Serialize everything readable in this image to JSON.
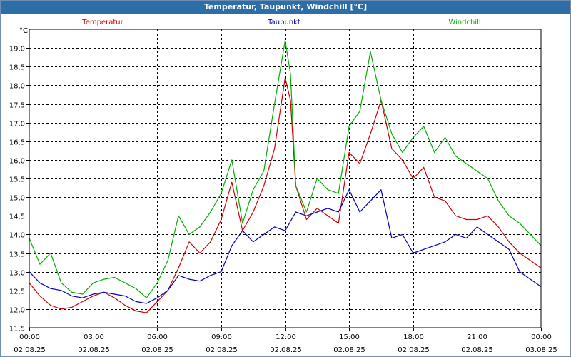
{
  "window": {
    "title": "Temperatur, Taupunkt, Windchill [°C]"
  },
  "colors": {
    "temperatur": "#d00000",
    "taupunkt": "#0000c0",
    "windchill": "#00b000",
    "grid": "#000000",
    "background": "#ffffff",
    "titlebar": "#2e6ea6"
  },
  "chart_data": {
    "type": "line",
    "title": "Temperatur, Taupunkt, Windchill [°C]",
    "ylabel": "°C",
    "ylim": [
      11.5,
      19.5
    ],
    "y_ticks": [
      11.5,
      12.0,
      12.5,
      13.0,
      13.5,
      14.0,
      14.5,
      15.0,
      15.5,
      16.0,
      16.5,
      17.0,
      17.5,
      18.0,
      18.5,
      19.0
    ],
    "y_tick_labels": [
      "11,5",
      "12,0",
      "12,5",
      "13,0",
      "13,5",
      "14,0",
      "14,5",
      "15,0",
      "15,5",
      "16,0",
      "16,5",
      "17,0",
      "17,5",
      "18,0",
      "18,5",
      "19,0"
    ],
    "x_ticks": [
      {
        "time": "00:00",
        "date": "02.08.25"
      },
      {
        "time": "03:00",
        "date": "02.08.25"
      },
      {
        "time": "06:00",
        "date": "02.08.25"
      },
      {
        "time": "09:00",
        "date": "02.08.25"
      },
      {
        "time": "12:00",
        "date": "02.08.25"
      },
      {
        "time": "15:00",
        "date": "02.08.25"
      },
      {
        "time": "18:00",
        "date": "02.08.25"
      },
      {
        "time": "21:00",
        "date": "02.08.25"
      },
      {
        "time": "00:00",
        "date": "03.08.25"
      }
    ],
    "xlim_hours": [
      0,
      24
    ],
    "grid": true,
    "legend_position": "top",
    "series": [
      {
        "name": "Temperatur",
        "color": "#d00000",
        "x": [
          0,
          0.5,
          1,
          1.5,
          2,
          2.5,
          3,
          3.5,
          4,
          4.5,
          5,
          5.5,
          6,
          6.5,
          7,
          7.5,
          8,
          8.5,
          9,
          9.5,
          10,
          10.5,
          11,
          11.5,
          12,
          12.25,
          12.5,
          13,
          13.5,
          14,
          14.5,
          15,
          15.5,
          16,
          16.5,
          17,
          17.5,
          18,
          18.5,
          19,
          19.5,
          20,
          20.5,
          21,
          21.5,
          22,
          22.5,
          23,
          23.5,
          24
        ],
        "y": [
          12.7,
          12.35,
          12.1,
          12.0,
          12.05,
          12.2,
          12.35,
          12.45,
          12.3,
          12.1,
          11.95,
          11.9,
          12.2,
          12.5,
          13.1,
          13.8,
          13.5,
          13.8,
          14.4,
          15.4,
          14.1,
          14.6,
          15.3,
          16.3,
          18.2,
          17.6,
          15.3,
          14.4,
          14.7,
          14.5,
          14.3,
          16.2,
          15.9,
          16.7,
          17.6,
          16.3,
          16.0,
          15.5,
          15.8,
          15.0,
          14.9,
          14.5,
          14.4,
          14.4,
          14.5,
          14.2,
          13.8,
          13.5,
          13.3,
          13.1
        ]
      },
      {
        "name": "Taupunkt",
        "color": "#0000c0",
        "x": [
          0,
          0.5,
          1,
          1.5,
          2,
          2.5,
          3,
          3.5,
          4,
          4.5,
          5,
          5.5,
          6,
          6.5,
          7,
          7.5,
          8,
          8.5,
          9,
          9.5,
          10,
          10.5,
          11,
          11.5,
          12,
          12.5,
          13,
          13.5,
          14,
          14.5,
          15,
          15.5,
          16,
          16.5,
          17,
          17.5,
          18,
          18.5,
          19,
          19.5,
          20,
          20.5,
          21,
          21.5,
          22,
          22.5,
          23,
          23.5,
          24
        ],
        "y": [
          13.0,
          12.7,
          12.55,
          12.5,
          12.35,
          12.3,
          12.4,
          12.45,
          12.4,
          12.35,
          12.2,
          12.15,
          12.3,
          12.5,
          12.9,
          12.8,
          12.75,
          12.9,
          13.0,
          13.7,
          14.1,
          13.8,
          14.0,
          14.2,
          14.1,
          14.6,
          14.5,
          14.6,
          14.7,
          14.6,
          15.2,
          14.6,
          14.9,
          15.2,
          13.9,
          14.0,
          13.5,
          13.6,
          13.7,
          13.8,
          14.0,
          13.9,
          14.2,
          14.0,
          13.8,
          13.6,
          13.0,
          12.8,
          12.6
        ]
      },
      {
        "name": "Windchill",
        "color": "#00b000",
        "x": [
          0,
          0.5,
          1,
          1.5,
          2,
          2.5,
          3,
          3.5,
          4,
          4.5,
          5,
          5.5,
          6,
          6.5,
          7,
          7.5,
          8,
          8.5,
          9,
          9.5,
          10,
          10.5,
          11,
          11.5,
          12,
          12.25,
          12.5,
          13,
          13.5,
          14,
          14.5,
          15,
          15.5,
          16,
          16.5,
          17,
          17.5,
          18,
          18.5,
          19,
          19.5,
          20,
          20.5,
          21,
          21.5,
          22,
          22.5,
          23,
          23.5,
          24
        ],
        "y": [
          13.9,
          13.2,
          13.5,
          12.7,
          12.45,
          12.4,
          12.7,
          12.8,
          12.85,
          12.7,
          12.55,
          12.3,
          12.7,
          13.3,
          14.5,
          14.0,
          14.2,
          14.6,
          15.1,
          16.0,
          14.3,
          15.2,
          15.7,
          17.5,
          19.2,
          18.3,
          15.3,
          14.6,
          15.5,
          15.2,
          15.1,
          16.9,
          17.3,
          18.9,
          17.6,
          16.7,
          16.2,
          16.6,
          16.9,
          16.2,
          16.6,
          16.1,
          15.9,
          15.7,
          15.5,
          14.9,
          14.5,
          14.3,
          14.0,
          13.7
        ]
      }
    ]
  }
}
